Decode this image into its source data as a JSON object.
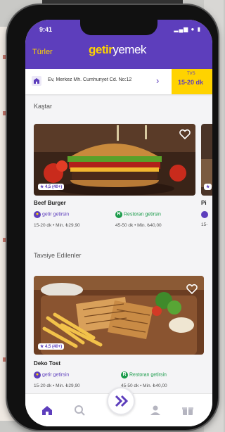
{
  "status": {
    "time": "9:41",
    "icons": "▂▄▆ ● ▮"
  },
  "header": {
    "left_label": "Türler",
    "logo_getir": "getir",
    "logo_yemek": "yemek",
    "bg_color": "#5d3ebc",
    "accent_color": "#ffd300"
  },
  "address": {
    "icon": "home-icon",
    "text": "Ev, Merkez Mh. Cumhuriyet Cd. No:12",
    "eta_label": "TVS",
    "eta_value": "15-20 dk"
  },
  "sections": {
    "cuisines": "Kaştar",
    "recommended": "Tavsiye Edilenler"
  },
  "restaurants": [
    {
      "name": "Beef Burger",
      "rating": "★ 4,5 (40+)",
      "delivery_label": "getir getirsin",
      "restaurant_label": "Restoran getirsin",
      "meta_left": "15-20 dk • Min. ₺29,90",
      "meta_right": "45-50 dk • Min. ₺40,00"
    },
    {
      "name": "Pi",
      "rating": "★",
      "delivery_label": "",
      "meta_left": "15-"
    },
    {
      "name": "Deko Tost",
      "rating": "★ 4,5 (40+)",
      "delivery_label": "getir getirsin",
      "restaurant_label": "Restoran getirsin",
      "meta_left": "15-20 dk • Min. ₺29,90",
      "meta_right": "45-50 dk • Min. ₺40,00"
    }
  ],
  "tabbar": {
    "items": [
      "home-icon",
      "search-icon",
      "getir-logo-icon",
      "profile-icon",
      "gift-icon"
    ]
  }
}
